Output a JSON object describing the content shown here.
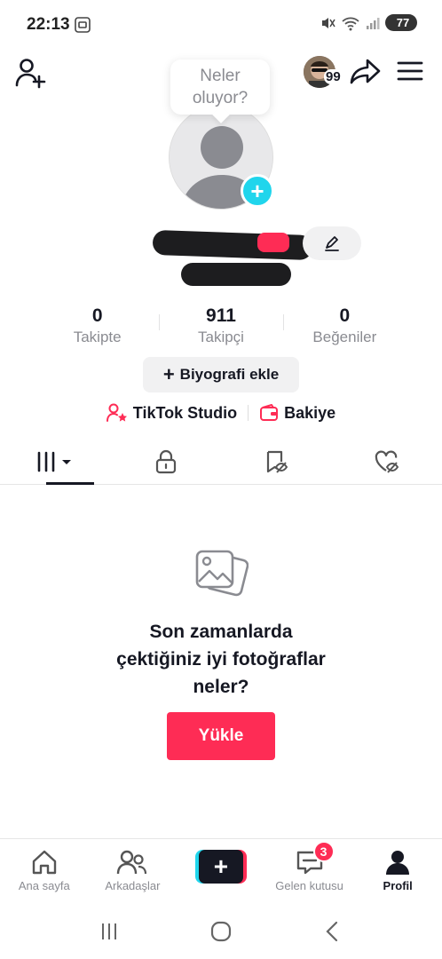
{
  "status_bar": {
    "time": "22:13",
    "battery": "77"
  },
  "header": {
    "avatar_badge": "99"
  },
  "tooltip": {
    "line1": "Neler",
    "line2": "oluyor?"
  },
  "profile": {
    "add_photo_icon": "+"
  },
  "stats": [
    {
      "value": "0",
      "label": "Takipte"
    },
    {
      "value": "911",
      "label": "Takipçi"
    },
    {
      "value": "0",
      "label": "Beğeniler"
    }
  ],
  "bio_button": {
    "plus": "+",
    "label": "Biyografi ekle"
  },
  "links": {
    "studio": "TikTok Studio",
    "balance": "Bakiye"
  },
  "empty_state": {
    "line1": "Son zamanlarda",
    "line2": "çektiğiniz iyi fotoğraflar",
    "line3": "neler?",
    "button": "Yükle"
  },
  "bottom_nav": {
    "home": "Ana sayfa",
    "friends": "Arkadaşlar",
    "create": "+",
    "inbox": "Gelen kutusu",
    "inbox_badge": "3",
    "profile": "Profil"
  },
  "colors": {
    "accent": "#fe2c55",
    "cyan": "#20d5ec",
    "text": "#161823",
    "muted": "#8a8b91"
  }
}
